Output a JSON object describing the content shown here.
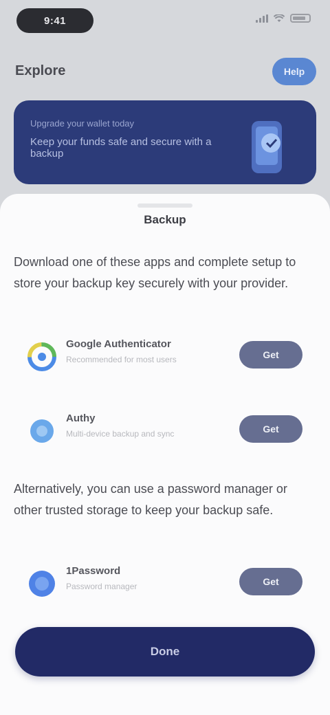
{
  "status_bar": {
    "time": "9:41"
  },
  "background": {
    "header_title": "Explore",
    "header_button": "Help",
    "banner_line1": "Upgrade your wallet today",
    "banner_line2": "Keep your funds safe and secure with a backup"
  },
  "sheet": {
    "title": "Backup",
    "paragraph1": "Download one of these apps and complete setup to store your backup key securely with your provider.",
    "paragraph2": "Alternatively, you can use a password manager or other trusted storage to keep your backup safe.",
    "apps": [
      {
        "name": "Google Authenticator",
        "subtitle": "Recommended for most users",
        "button": "Get"
      },
      {
        "name": "Authy",
        "subtitle": "Multi-device backup and sync",
        "button": "Get"
      },
      {
        "name": "1Password",
        "subtitle": "Password manager",
        "button": "Get"
      }
    ],
    "primary_button": "Done"
  }
}
